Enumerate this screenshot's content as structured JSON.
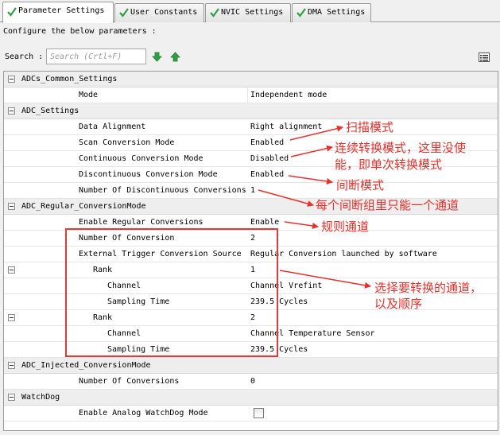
{
  "tabs": [
    {
      "label": "Parameter Settings",
      "active": true
    },
    {
      "label": "User Constants",
      "active": false
    },
    {
      "label": "NVIC Settings",
      "active": false
    },
    {
      "label": "DMA Settings",
      "active": false
    }
  ],
  "description": "Configure the below parameters :",
  "search": {
    "label": "Search :",
    "placeholder": "Search (Crtl+F)"
  },
  "groups": {
    "adc_common": {
      "title": "ADCs_Common_Settings",
      "params": [
        {
          "name": "Mode",
          "value": "Independent mode"
        }
      ]
    },
    "adc_settings": {
      "title": "ADC_Settings",
      "params": [
        {
          "name": "Data Alignment",
          "value": "Right alignment"
        },
        {
          "name": "Scan Conversion Mode",
          "value": "Enabled"
        },
        {
          "name": "Continuous Conversion Mode",
          "value": "Disabled"
        },
        {
          "name": "Discontinuous Conversion Mode",
          "value": "Enabled"
        },
        {
          "name": "Number Of Discontinuous Conversions",
          "value": "1"
        }
      ]
    },
    "regular": {
      "title": "ADC_Regular_ConversionMode",
      "params": [
        {
          "name": "Enable Regular Conversions",
          "value": "Enable"
        },
        {
          "name": "Number Of Conversion",
          "value": "2"
        },
        {
          "name": "External Trigger Conversion Source",
          "value": "Regular Conversion launched by software"
        }
      ],
      "ranks": [
        {
          "label": "Rank",
          "value": "1",
          "channel_label": "Channel",
          "channel": "Channel Vrefint",
          "sampling_label": "Sampling Time",
          "sampling": "239.5 Cycles"
        },
        {
          "label": "Rank",
          "value": "2",
          "channel_label": "Channel",
          "channel": "Channel Temperature Sensor",
          "sampling_label": "Sampling Time",
          "sampling": "239.5 Cycles"
        }
      ]
    },
    "injected": {
      "title": "ADC_Injected_ConversionMode",
      "params": [
        {
          "name": "Number Of Conversions",
          "value": "0"
        }
      ]
    },
    "watchdog": {
      "title": "WatchDog",
      "params": [
        {
          "name": "Enable Analog WatchDog Mode",
          "checked": false
        }
      ]
    }
  },
  "annotations": {
    "scan": "扫描模式",
    "continuous_line1": "连续转换模式，这里没使",
    "continuous_line2": "能，即单次转换模式",
    "discontinuous": "间断模式",
    "one_channel": "每个间断组里只能一个通道",
    "regular": "规则通道",
    "select_line1": "选择要转换的通道，",
    "select_line2": "以及顺序"
  },
  "colors": {
    "accent_red": "#e8302c",
    "check_green": "#2ea043",
    "arrow_green": "#2ea043"
  },
  "icons": [
    "check-icon",
    "arrow-down-icon",
    "arrow-up-icon",
    "list-icon",
    "collapse-icon"
  ]
}
